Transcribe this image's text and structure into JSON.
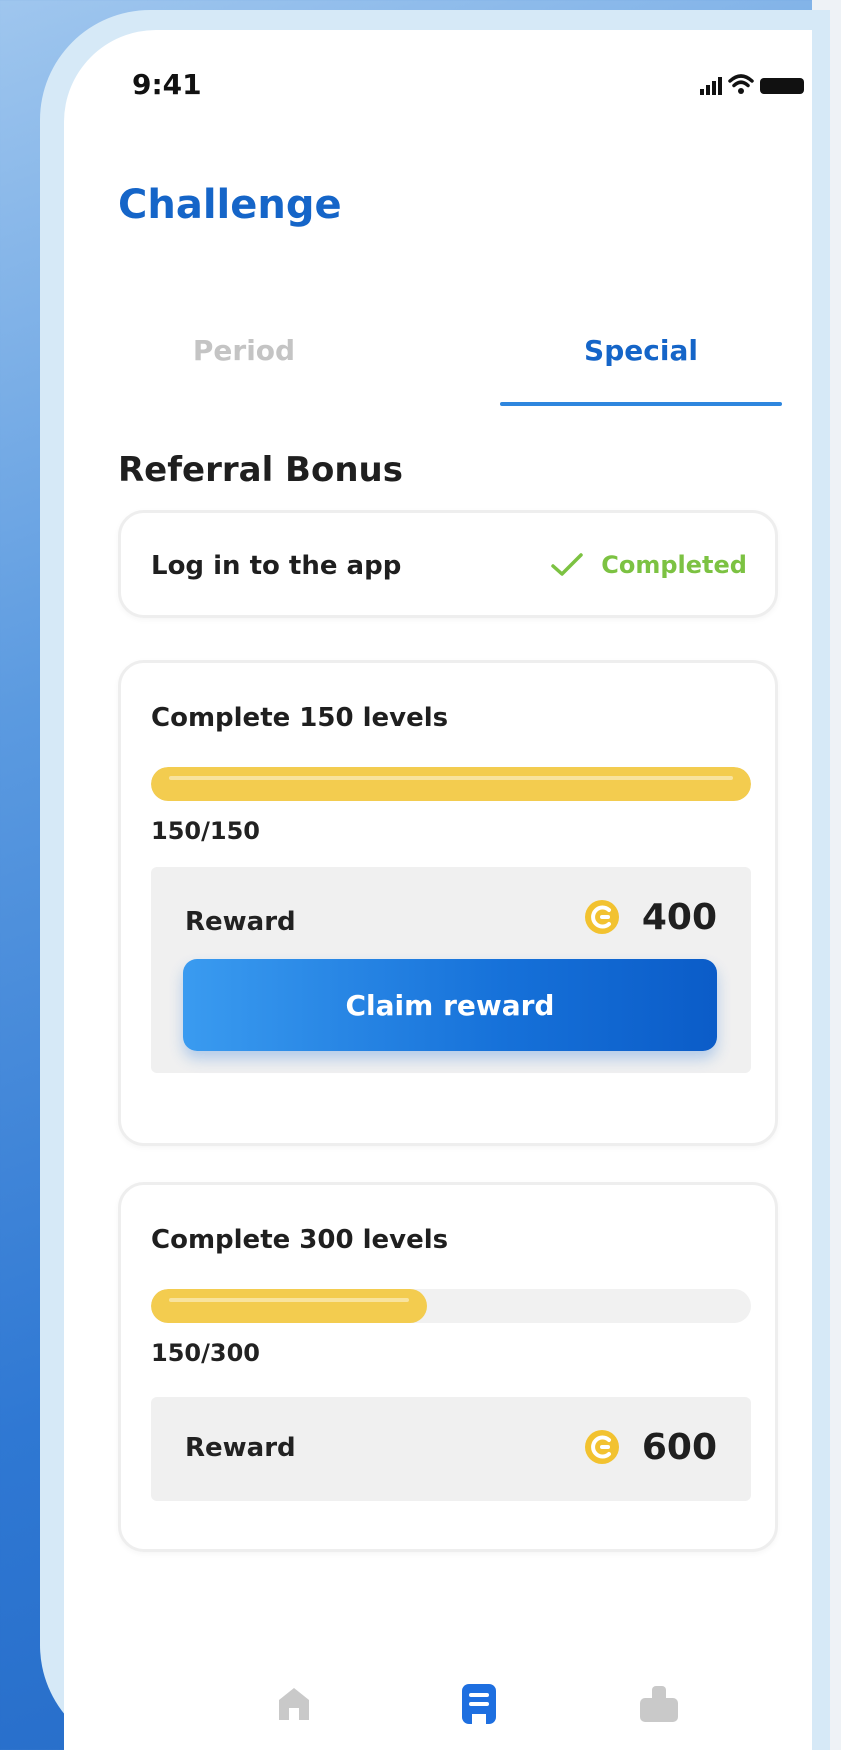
{
  "status_bar": {
    "time": "9:41"
  },
  "header": {
    "title": "Challenge"
  },
  "tabs": [
    {
      "label": "Period",
      "active": false
    },
    {
      "label": "Special",
      "active": true
    }
  ],
  "section": {
    "title": "Referral Bonus"
  },
  "tasks": [
    {
      "label": "Log in to the app",
      "status": "Completed"
    },
    {
      "label": "Complete 150 levels",
      "progress_current": 150,
      "progress_total": 150,
      "progress_text": "150/150",
      "reward_label": "Reward",
      "reward_amount": "400",
      "claim_label": "Claim reward"
    },
    {
      "label": "Complete 300 levels",
      "progress_current": 150,
      "progress_total": 300,
      "progress_text": "150/300",
      "reward_label": "Reward",
      "reward_amount": "600"
    }
  ],
  "nav": [
    {
      "icon": "home-icon",
      "active": false
    },
    {
      "icon": "challenge-icon",
      "active": true
    },
    {
      "icon": "shop-icon",
      "active": false
    }
  ],
  "colors": {
    "accent": "#1565c8",
    "progress": "#f3cc4f",
    "completed": "#7cc242",
    "coin": "#f2c230"
  }
}
